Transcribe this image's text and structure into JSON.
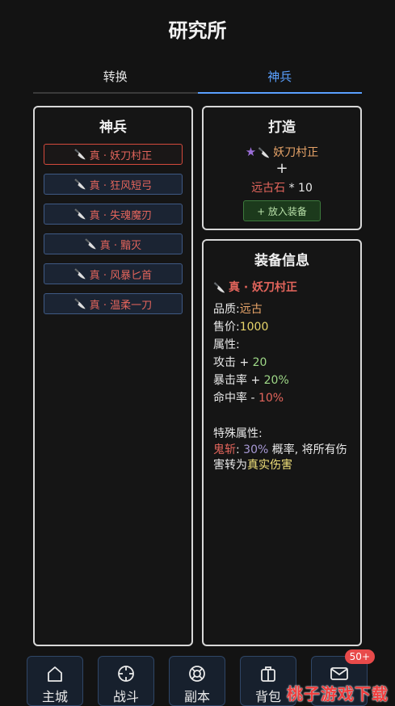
{
  "header": {
    "title": "研究所"
  },
  "tabs": [
    {
      "label": "转换",
      "active": false
    },
    {
      "label": "神兵",
      "active": true
    }
  ],
  "weapon_panel": {
    "title": "神兵",
    "items": [
      {
        "label": "真 · 妖刀村正",
        "selected": true
      },
      {
        "label": "真 · 狂风短弓",
        "selected": false
      },
      {
        "label": "真 · 失魂魔刃",
        "selected": false
      },
      {
        "label": "真 · 黯灭",
        "selected": false
      },
      {
        "label": "真 · 风暴匕首",
        "selected": false
      },
      {
        "label": "真 · 温柔一刀",
        "selected": false
      }
    ]
  },
  "forge_panel": {
    "title": "打造",
    "base_weapon": "妖刀村正",
    "plus": "+",
    "material_name": "远古石",
    "material_qty": " * 10",
    "equip_button": "+ 放入装备"
  },
  "info_panel": {
    "title": "装备信息",
    "name": "真 · 妖刀村正",
    "quality_label": "品质:",
    "quality_value": "远古",
    "price_label": "售价:",
    "price_value": "1000",
    "attributes_label": "属性:",
    "attack_label": "攻击 + ",
    "attack_value": "20",
    "crit_label": "暴击率 + ",
    "crit_value": "20%",
    "hit_label": "命中率 - ",
    "hit_value": "10%",
    "special_label": "特殊属性:",
    "special_name": "鬼斩",
    "special_colon": ": ",
    "special_chance": "30%",
    "special_text1": " 概率, 将所有伤害转为",
    "special_highlight": "真实伤害"
  },
  "bottom_nav": {
    "items": [
      {
        "label": "主城",
        "icon": "home-icon"
      },
      {
        "label": "战斗",
        "icon": "crosshair-icon"
      },
      {
        "label": "副本",
        "icon": "lifebuoy-icon"
      },
      {
        "label": "背包",
        "icon": "bag-icon"
      },
      {
        "label": "",
        "icon": "mail-icon"
      }
    ],
    "mail_badge": "50+"
  },
  "watermark": "桃子游戏下载",
  "colors": {
    "accent_blue": "#5aa0ff",
    "weapon_red": "#e4655c",
    "ancient_orange": "#e6a368",
    "price_yellow": "#e8d56a",
    "positive_green": "#9ed887",
    "badge_red": "#e84a4a"
  }
}
